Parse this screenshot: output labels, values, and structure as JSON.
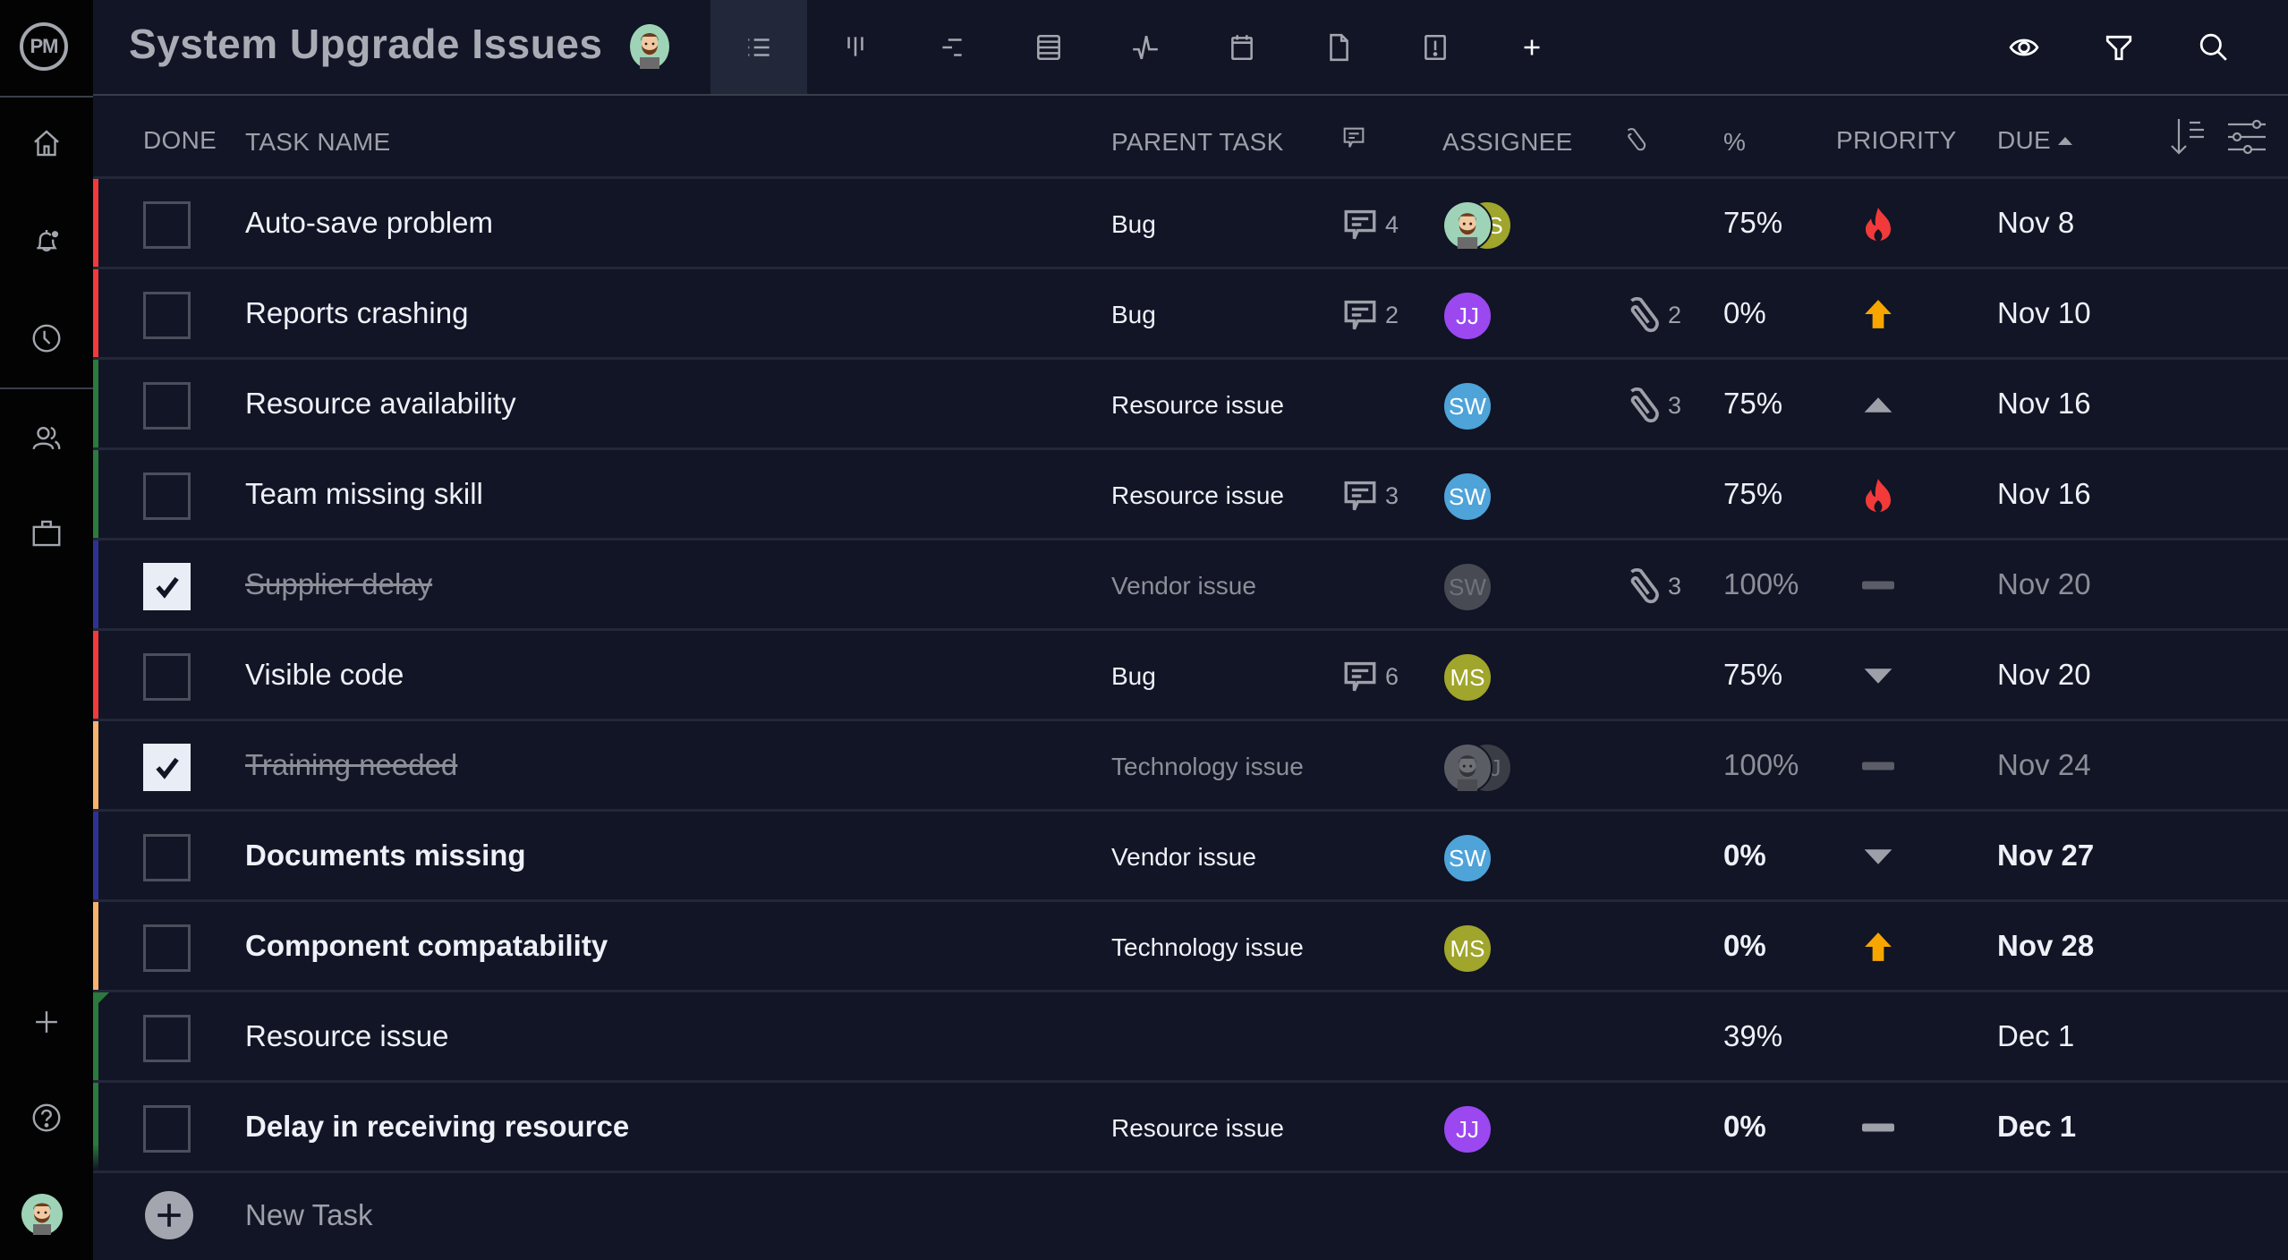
{
  "app": {
    "logo_text": "PM"
  },
  "sidebar": {
    "items": [
      {
        "name": "home",
        "icon": "home-icon"
      },
      {
        "name": "notifications",
        "icon": "bell-icon"
      },
      {
        "name": "recent",
        "icon": "clock-icon"
      },
      {
        "name": "team",
        "icon": "users-icon"
      },
      {
        "name": "portfolio",
        "icon": "briefcase-icon"
      },
      {
        "name": "add",
        "icon": "plus-icon"
      },
      {
        "name": "help",
        "icon": "help-icon"
      }
    ]
  },
  "header": {
    "title": "System Upgrade Issues",
    "views": [
      {
        "name": "list",
        "icon": "list-icon",
        "active": true
      },
      {
        "name": "board",
        "icon": "board-icon",
        "active": false
      },
      {
        "name": "gantt",
        "icon": "gantt-icon",
        "active": false
      },
      {
        "name": "sheet",
        "icon": "sheet-icon",
        "active": false
      },
      {
        "name": "dashboard",
        "icon": "pulse-icon",
        "active": false
      },
      {
        "name": "calendar",
        "icon": "calendar-icon",
        "active": false
      },
      {
        "name": "files",
        "icon": "file-icon",
        "active": false
      },
      {
        "name": "issues",
        "icon": "alert-icon",
        "active": false
      },
      {
        "name": "add-view",
        "icon": "plus-icon",
        "active": false
      }
    ],
    "actions": [
      {
        "name": "show",
        "icon": "eye-icon"
      },
      {
        "name": "filter",
        "icon": "filter-icon"
      },
      {
        "name": "search",
        "icon": "search-icon"
      }
    ]
  },
  "table": {
    "columns": {
      "done": "DONE",
      "task_name": "TASK NAME",
      "parent_task": "PARENT TASK",
      "comments_icon": "comment-icon",
      "assignee": "ASSIGNEE",
      "attachments_icon": "paperclip-icon",
      "percent": "%",
      "priority": "PRIORITY",
      "due": "DUE",
      "due_sort": "ascending"
    },
    "colors": {
      "red": "#f23a3a",
      "green": "#2b7a3c",
      "navy": "#2e3192",
      "peach": "#f7b36b",
      "priority_critical": "#f23a3a",
      "priority_high": "#f7a600",
      "priority_neutral": "#9da0a9",
      "priority_none": "#5a5d67"
    },
    "rows": [
      {
        "done": false,
        "name": "Auto-save problem",
        "bold": false,
        "parent": "Bug",
        "comments": "4",
        "attachments": "",
        "percent": "75%",
        "priority": "critical",
        "due": "Nov 8",
        "bar": "red",
        "assignees": [
          {
            "type": "photo",
            "initials": "",
            "color": "#9fd3b8"
          },
          {
            "type": "initials",
            "initials": "S",
            "color": "#a0a52b"
          }
        ]
      },
      {
        "done": false,
        "name": "Reports crashing",
        "bold": false,
        "parent": "Bug",
        "comments": "2",
        "attachments": "2",
        "percent": "0%",
        "priority": "high",
        "due": "Nov 10",
        "bar": "red",
        "assignees": [
          {
            "type": "initials",
            "initials": "JJ",
            "color": "#9b48f0"
          }
        ]
      },
      {
        "done": false,
        "name": "Resource availability",
        "bold": false,
        "parent": "Resource issue",
        "comments": "",
        "attachments": "3",
        "percent": "75%",
        "priority": "medium",
        "due": "Nov 16",
        "bar": "green",
        "assignees": [
          {
            "type": "initials",
            "initials": "SW",
            "color": "#4ea3d9"
          }
        ]
      },
      {
        "done": false,
        "name": "Team missing skill",
        "bold": false,
        "parent": "Resource issue",
        "comments": "3",
        "attachments": "",
        "percent": "75%",
        "priority": "critical",
        "due": "Nov 16",
        "bar": "green",
        "assignees": [
          {
            "type": "initials",
            "initials": "SW",
            "color": "#4ea3d9"
          }
        ]
      },
      {
        "done": true,
        "name": "Supplier delay",
        "bold": false,
        "parent": "Vendor issue",
        "comments": "",
        "attachments": "3",
        "percent": "100%",
        "priority": "none",
        "due": "Nov 20",
        "bar": "navy",
        "assignees": [
          {
            "type": "initials",
            "initials": "SW",
            "color": "#474a52"
          }
        ]
      },
      {
        "done": false,
        "name": "Visible code",
        "bold": false,
        "parent": "Bug",
        "comments": "6",
        "attachments": "",
        "percent": "75%",
        "priority": "low",
        "due": "Nov 20",
        "bar": "red",
        "assignees": [
          {
            "type": "initials",
            "initials": "MS",
            "color": "#a0a52b"
          }
        ]
      },
      {
        "done": true,
        "name": "Training needed",
        "bold": false,
        "parent": "Technology issue",
        "comments": "",
        "attachments": "",
        "percent": "100%",
        "priority": "none",
        "due": "Nov 24",
        "bar": "peach",
        "assignees": [
          {
            "type": "photo-dim",
            "initials": "",
            "color": "#55585f"
          },
          {
            "type": "initials",
            "initials": "J",
            "color": "#3a3d45"
          }
        ]
      },
      {
        "done": false,
        "name": "Documents missing",
        "bold": true,
        "parent": "Vendor issue",
        "comments": "",
        "attachments": "",
        "percent": "0%",
        "priority": "low",
        "due": "Nov 27",
        "bar": "navy",
        "assignees": [
          {
            "type": "initials",
            "initials": "SW",
            "color": "#4ea3d9"
          }
        ]
      },
      {
        "done": false,
        "name": "Component compatability",
        "bold": true,
        "parent": "Technology issue",
        "comments": "",
        "attachments": "",
        "percent": "0%",
        "priority": "high",
        "due": "Nov 28",
        "bar": "peach",
        "assignees": [
          {
            "type": "initials",
            "initials": "MS",
            "color": "#a0a52b"
          }
        ]
      },
      {
        "done": false,
        "name": "Resource issue",
        "bold": false,
        "parent": "",
        "comments": "",
        "attachments": "",
        "percent": "39%",
        "priority": "",
        "due": "Dec 1",
        "bar": "green-parent",
        "assignees": []
      },
      {
        "done": false,
        "name": "Delay in receiving resource",
        "bold": true,
        "parent": "Resource issue",
        "comments": "",
        "attachments": "",
        "percent": "0%",
        "priority": "none-light",
        "due": "Dec 1",
        "bar": "green-fade",
        "assignees": [
          {
            "type": "initials",
            "initials": "JJ",
            "color": "#9b48f0"
          }
        ]
      }
    ],
    "new_task_label": "New Task"
  }
}
